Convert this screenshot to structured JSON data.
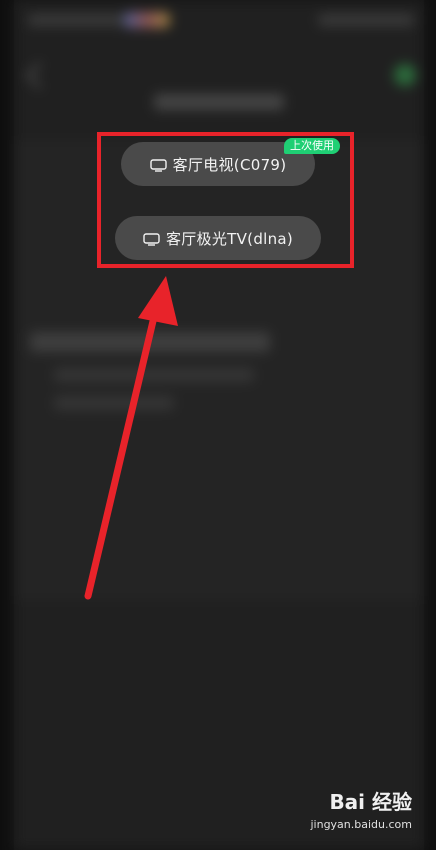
{
  "dialog": {
    "devices": [
      {
        "label": "客厅电视(C079)",
        "icon": "tv-icon"
      },
      {
        "label": "客厅极光TV(dlna)",
        "icon": "tv-icon"
      }
    ],
    "last_used_badge": "上次使用"
  },
  "annotation": {
    "box_color": "#e8232a",
    "arrow_color": "#e8232a"
  },
  "watermark": {
    "logo_text": "Bai 经验",
    "url": "jingyan.baidu.com"
  },
  "colors": {
    "button_bg": "#4a4a4a",
    "badge_bg": "#1fcf74",
    "background": "#141414"
  }
}
